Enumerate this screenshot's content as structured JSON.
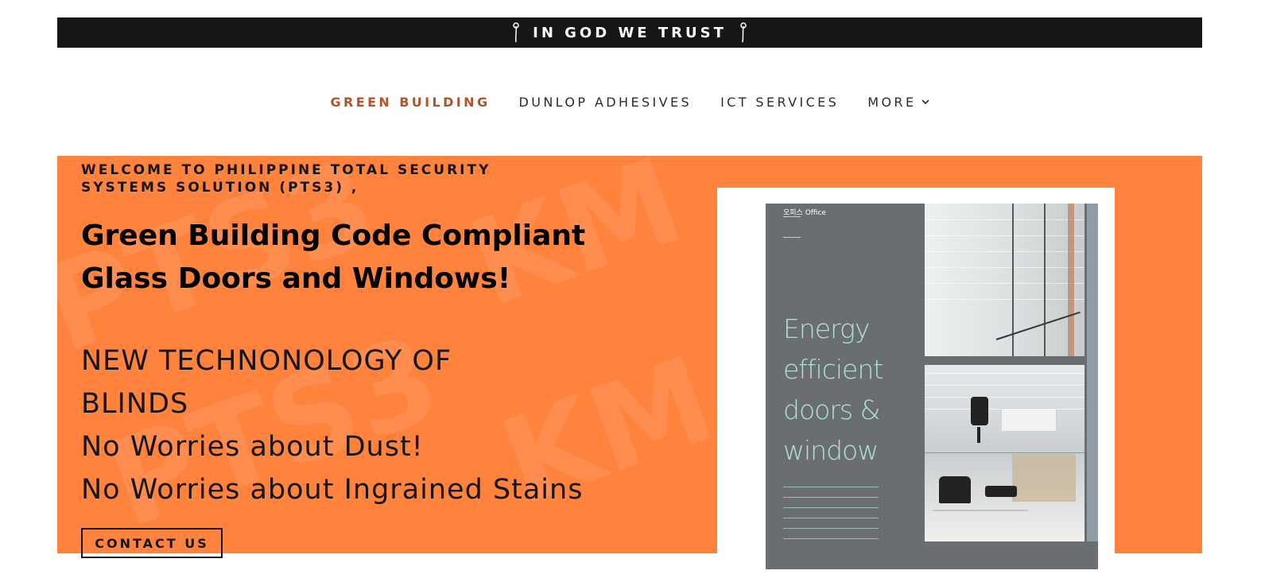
{
  "topbar": {
    "text": "IN GOD WE TRUST"
  },
  "nav": {
    "items": [
      {
        "label": "GREEN BUILDING",
        "active": true
      },
      {
        "label": "DUNLOP ADHESIVES",
        "active": false
      },
      {
        "label": "ICT SERVICES",
        "active": false
      },
      {
        "label": "MORE",
        "active": false
      }
    ]
  },
  "hero": {
    "eyebrow": "WELCOME TO PHILIPPINE TOTAL SECURITY SYSTEMS SOLUTION (PTS3) ,",
    "headline_line1": "Green Building Code Compliant",
    "headline_line2": "Glass Doors and Windows!",
    "body_line1": "NEW TECHNONOLOGY OF",
    "body_line2": "BLINDS",
    "body_line3": "No Worries about Dust!",
    "body_line4": "No Worries about Ingrained Stains",
    "cta_label": "CONTACT US",
    "background_color": "#ff823d",
    "watermark_text": [
      "PTS3",
      "KM",
      "PTS3",
      "KM"
    ]
  },
  "brochure": {
    "label": "오피스 Office",
    "energy_line1": "Energy",
    "energy_line2": "efficient",
    "energy_line3": "doors &",
    "energy_line4": "window"
  }
}
